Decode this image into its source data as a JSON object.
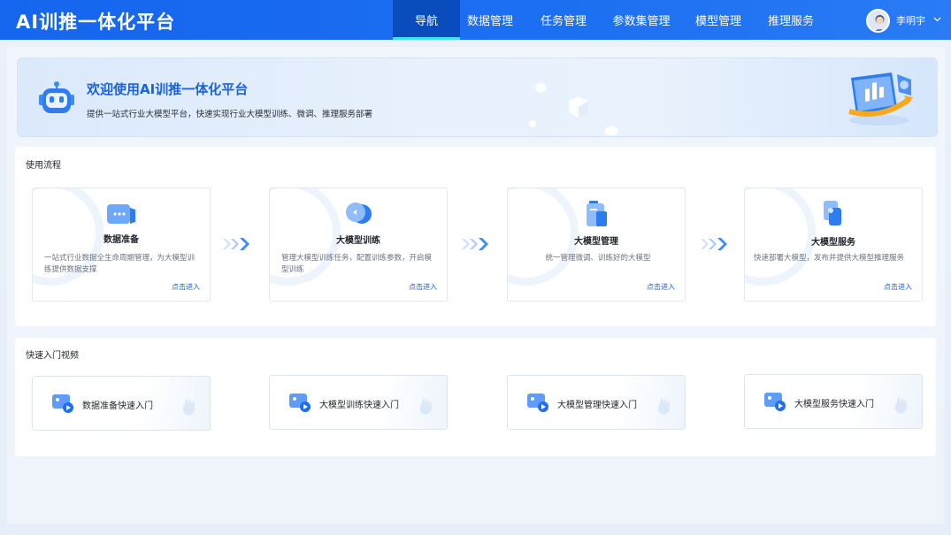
{
  "app": {
    "title": "AI训推一体化平台"
  },
  "nav": {
    "items": [
      {
        "label": "导航",
        "active": true
      },
      {
        "label": "数据管理",
        "active": false
      },
      {
        "label": "任务管理",
        "active": false
      },
      {
        "label": "参数集管理",
        "active": false
      },
      {
        "label": "模型管理",
        "active": false
      },
      {
        "label": "推理服务",
        "active": false
      }
    ]
  },
  "user": {
    "name": "李明宇"
  },
  "banner": {
    "title": "欢迎使用AI训推一体化平台",
    "subtitle": "提供一站式行业大模型平台，快速实现行业大模型训练、微调、推理服务部署"
  },
  "flow": {
    "title": "使用流程",
    "steps": [
      {
        "title": "数据准备",
        "desc": "一站式行业数据全生命周期管理，为大模型训练提供数据支撑",
        "link": "点击进入",
        "icon": "data-icon"
      },
      {
        "title": "大模型训练",
        "desc": "管理大模型训练任务，配置训练参数，开启模型训练",
        "link": "点击进入",
        "icon": "training-icon"
      },
      {
        "title": "大模型管理",
        "desc": "统一管理微调、训练好的大模型",
        "link": "点击进入",
        "icon": "model-manage-icon"
      },
      {
        "title": "大模型服务",
        "desc": "快速部署大模型，发布并提供大模型推理服务",
        "link": "点击进入",
        "icon": "model-service-icon"
      }
    ]
  },
  "videos": {
    "title": "快速入门视频",
    "items": [
      {
        "label": "数据准备快速入门",
        "icon": "video-icon"
      },
      {
        "label": "大模型训练快速入门",
        "icon": "video-icon"
      },
      {
        "label": "大模型管理快速入门",
        "icon": "video-icon"
      },
      {
        "label": "大模型服务快速入门",
        "icon": "video-icon"
      }
    ]
  },
  "colors": {
    "nav_bg": "#1a6cf0",
    "nav_active": "#0a4bbd",
    "nav_active_underline": "#3fe0ff",
    "accent": "#1a63e0"
  }
}
